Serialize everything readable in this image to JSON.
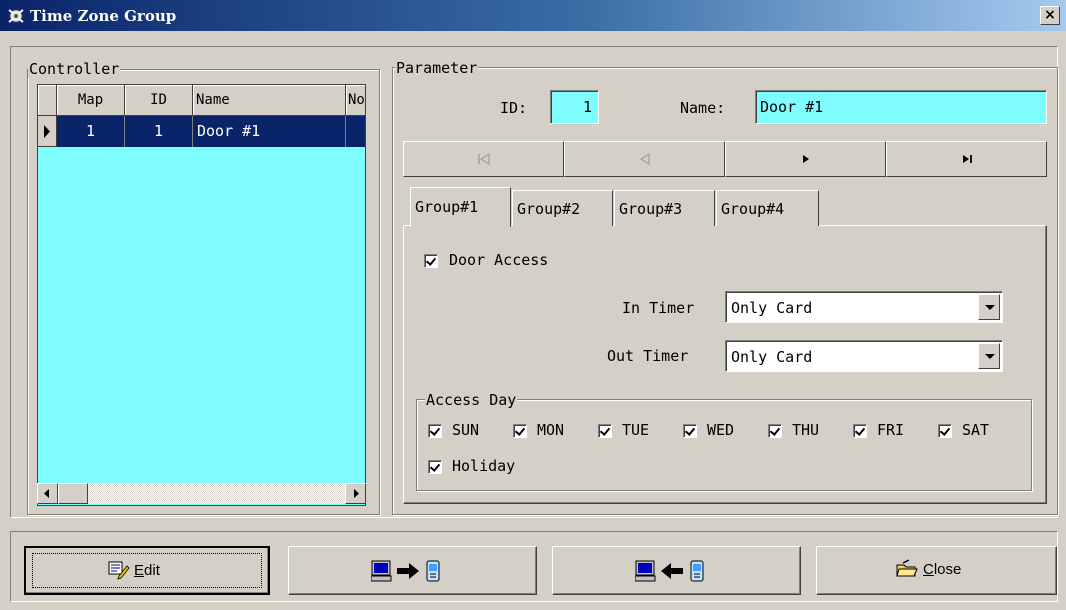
{
  "window": {
    "title": "Time Zone Group",
    "close_glyph": "×"
  },
  "controller": {
    "legend": "Controller",
    "columns": [
      "Map",
      "ID",
      "Name",
      "No"
    ],
    "rows": [
      {
        "map": "1",
        "id": "1",
        "name": "Door #1"
      }
    ],
    "row_color": "#0a246a",
    "background_color": "#7ffcff"
  },
  "parameter": {
    "legend": "Parameter",
    "id_label": "ID:",
    "id_value": "1",
    "name_label": "Name:",
    "name_value": "Door #1",
    "nav_buttons": [
      {
        "name": "first-record",
        "icon": "first-icon"
      },
      {
        "name": "prev-record",
        "icon": "prev-icon"
      },
      {
        "name": "next-record",
        "icon": "next-icon"
      },
      {
        "name": "last-record",
        "icon": "last-icon"
      }
    ],
    "tabs": [
      "Group#1",
      "Group#2",
      "Group#3",
      "Group#4"
    ],
    "active_tab": "Group#1",
    "door_access": {
      "label": "Door Access",
      "checked": true
    },
    "in_timer": {
      "label": "In Timer",
      "value": "Only Card"
    },
    "out_timer": {
      "label": "Out Timer",
      "value": "Only Card"
    },
    "access_day": {
      "legend": "Access Day",
      "days": [
        {
          "label": "SUN",
          "checked": true
        },
        {
          "label": "MON",
          "checked": true
        },
        {
          "label": "TUE",
          "checked": true
        },
        {
          "label": "WED",
          "checked": true
        },
        {
          "label": "THU",
          "checked": true
        },
        {
          "label": "FRI",
          "checked": true
        },
        {
          "label": "SAT",
          "checked": true
        }
      ],
      "holiday": {
        "label": "Holiday",
        "checked": true
      }
    }
  },
  "footer": {
    "edit": {
      "label_u": "E",
      "label_rest": "dit",
      "icon": "edit-icon"
    },
    "upload": {
      "icon": "pc-to-device-icon"
    },
    "download": {
      "icon": "device-to-pc-icon"
    },
    "close": {
      "label_u": "C",
      "label_rest": "lose",
      "icon": "folder-close-icon"
    }
  }
}
